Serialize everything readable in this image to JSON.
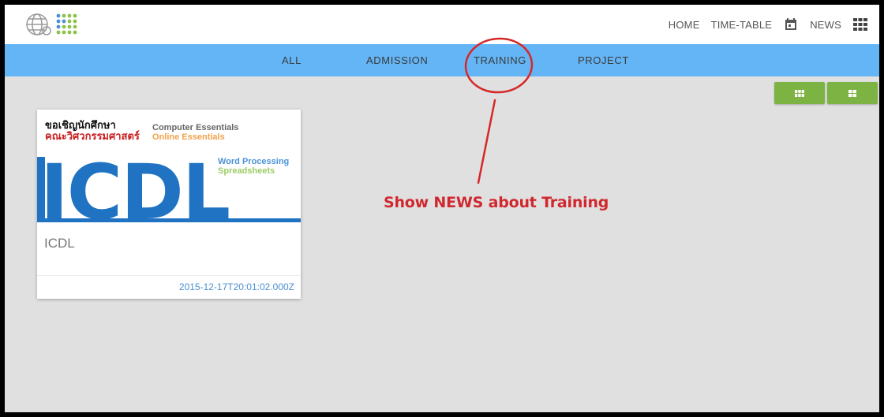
{
  "topnav": {
    "home": "HOME",
    "timetable": "TIME-TABLE",
    "news": "NEWS"
  },
  "categories": [
    "ALL",
    "ADMISSION",
    "TRAINING",
    "PROJECT"
  ],
  "news": [
    {
      "image": {
        "thai_line1": "ขอเชิญนักศึกษา",
        "thai_line2": "คณะวิศวกรรมศาสตร์",
        "module1": "Computer Essentials",
        "module2": "Online Essentials",
        "module3": "Word Processing",
        "module4": "Spreadsheets",
        "brand": "ICDL"
      },
      "title": "ICDL",
      "date": "2015-12-17T20:01:02.000Z"
    }
  ],
  "annotation": "Show NEWS about Training",
  "colors": {
    "catbar": "#64b5f6",
    "view_button": "#7cb342",
    "annotation": "#d0282e"
  },
  "icons": {
    "logo": "globe-dots-logo",
    "timetable": "calendar-icon",
    "news": "grid-icon",
    "view1": "grid-view-icon",
    "view2": "list-view-icon"
  }
}
